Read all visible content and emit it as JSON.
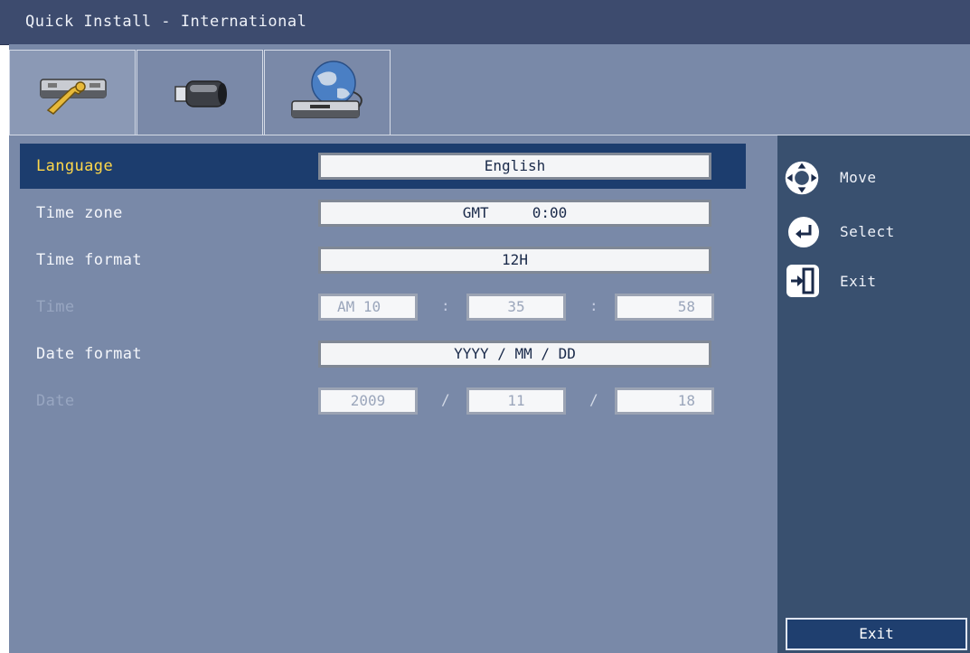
{
  "window": {
    "title": "Quick Install - International"
  },
  "tabs": [
    {
      "name": "system-tab",
      "icon": "wrench-recorder-icon",
      "active": true
    },
    {
      "name": "camera-tab",
      "icon": "camera-icon",
      "active": false
    },
    {
      "name": "network-tab",
      "icon": "globe-network-icon",
      "active": false
    }
  ],
  "settings": {
    "language": {
      "label": "Language",
      "value": "English"
    },
    "timezone": {
      "label": "Time zone",
      "value": "GMT     0:00"
    },
    "timeformat": {
      "label": "Time format",
      "value": "12H"
    },
    "time": {
      "label": "Time",
      "hour": "AM 10",
      "minute": "35",
      "second": "58",
      "sep": ":"
    },
    "dateformat": {
      "label": "Date format",
      "value": "YYYY / MM / DD"
    },
    "date": {
      "label": "Date",
      "year": "2009",
      "month": "11",
      "day": "18",
      "sep": "/"
    }
  },
  "help": {
    "move": "Move",
    "select": "Select",
    "exit": "Exit"
  },
  "exit_button": "Exit",
  "colors": {
    "selected_row": "#1c3d6e",
    "selected_label": "#ffd84a",
    "panel": "#39506f"
  }
}
